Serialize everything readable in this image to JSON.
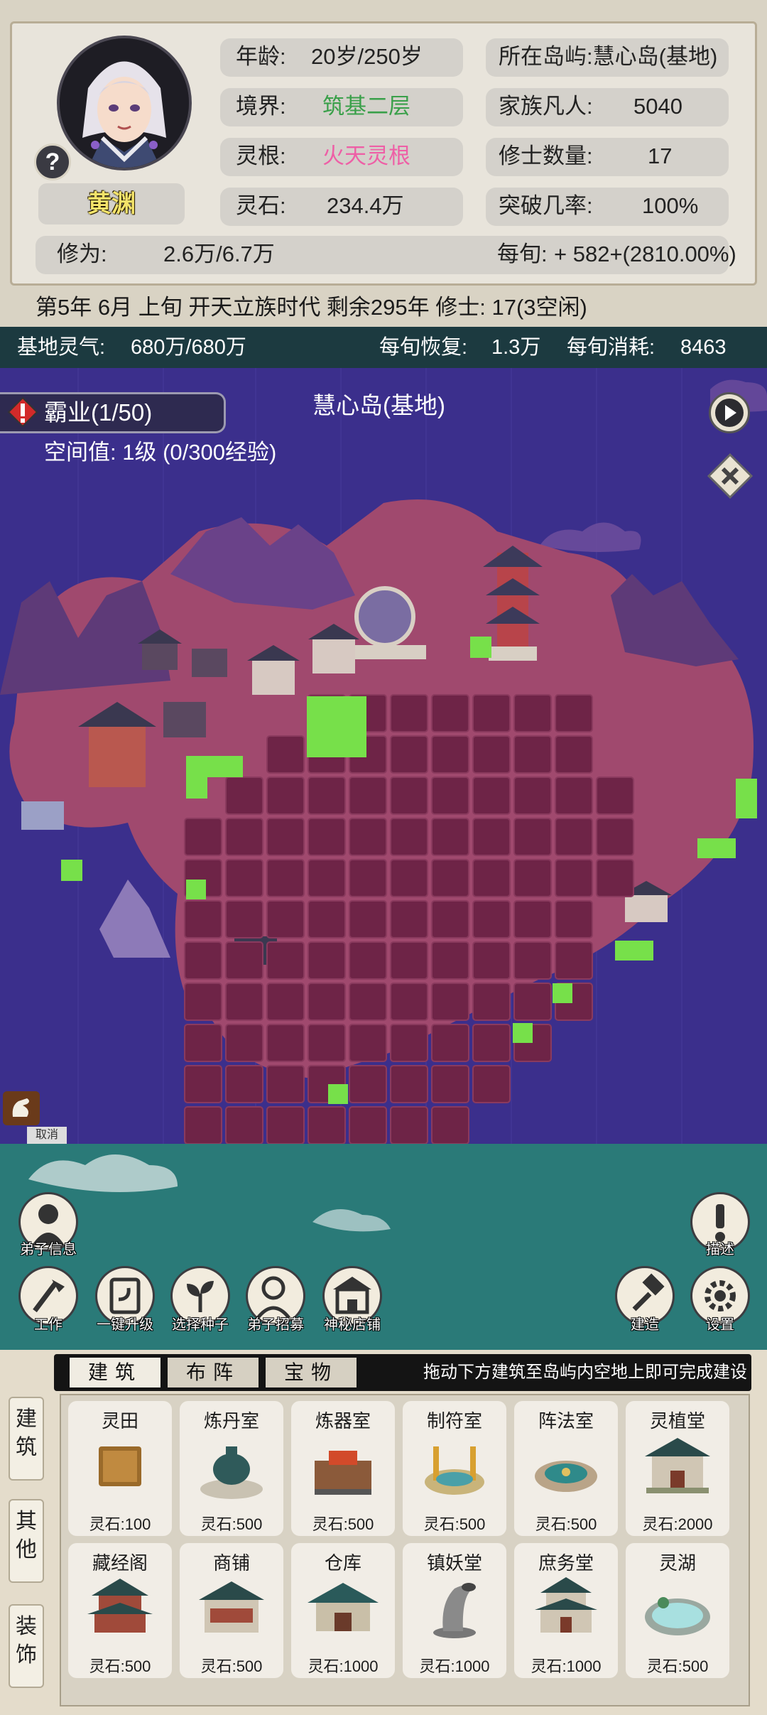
{
  "character": {
    "name": "黄渊",
    "age_label": "年龄:",
    "age_value": "20岁/250岁",
    "realm_label": "境界:",
    "realm_value": "筑基二层",
    "root_label": "灵根:",
    "root_value": "火天灵根",
    "stone_label": "灵石:",
    "stone_value": "234.4万",
    "island_label": "所在岛屿:",
    "island_value": "慧心岛(基地)",
    "mortals_label": "家族凡人:",
    "mortals_value": "5040",
    "cultivators_label": "修士数量:",
    "cultivators_value": "17",
    "breakthrough_label": "突破几率:",
    "breakthrough_value": "100%",
    "cultivation_label": "修为:",
    "cultivation_value": "2.6万/6.7万",
    "per_turn_label": "每旬:",
    "per_turn_value": "+ 582+(2810.00%)",
    "help_symbol": "?"
  },
  "status_line": "第5年 6月 上旬  开天立族时代 剩余295年  修士: 17(3空闲)",
  "spirit": {
    "base_label": "基地灵气:",
    "base_value": "680万/680万",
    "recover_label": "每旬恢复:",
    "recover_value": "1.3万",
    "consume_label": "每旬消耗:",
    "consume_value": "8463"
  },
  "map": {
    "battle": "霸业(1/50)",
    "space_level": "空间值: 1级 (0/300经验)",
    "island_name": "慧心岛(基地)",
    "cancel": "取消",
    "colors": {
      "water": "#3b2f8c",
      "land": "#a0496e",
      "plot": "#6e2447",
      "empty_tile": "#77e04a",
      "mountain": "#5e3a78"
    }
  },
  "actions": {
    "disciple_info": "弟子信息",
    "describe": "描述",
    "work": "工作",
    "upgrade_all": "一键升级",
    "choose_seed": "选择种子",
    "recruit": "弟子招募",
    "mystery_shop": "神秘店铺",
    "build": "建造",
    "settings": "设置"
  },
  "build_panel": {
    "side_tabs": [
      "建筑",
      "其他",
      "装饰"
    ],
    "tabs": [
      "建筑",
      "布阵",
      "宝物"
    ],
    "hint": "拖动下方建筑至岛屿内空地上即可完成建设",
    "buildings": [
      {
        "name": "灵田",
        "price": "灵石:100",
        "icon": "field-icon"
      },
      {
        "name": "炼丹室",
        "price": "灵石:500",
        "icon": "cauldron-icon"
      },
      {
        "name": "炼器室",
        "price": "灵石:500",
        "icon": "forge-icon"
      },
      {
        "name": "制符室",
        "price": "灵石:500",
        "icon": "talisman-altar-icon"
      },
      {
        "name": "阵法室",
        "price": "灵石:500",
        "icon": "formation-disc-icon"
      },
      {
        "name": "灵植堂",
        "price": "灵石:2000",
        "icon": "hall-icon"
      },
      {
        "name": "藏经阁",
        "price": "灵石:500",
        "icon": "pavilion-icon"
      },
      {
        "name": "商铺",
        "price": "灵石:500",
        "icon": "shop-icon"
      },
      {
        "name": "仓库",
        "price": "灵石:1000",
        "icon": "warehouse-icon"
      },
      {
        "name": "镇妖堂",
        "price": "灵石:1000",
        "icon": "horn-icon"
      },
      {
        "name": "庶务堂",
        "price": "灵石:1000",
        "icon": "office-hall-icon"
      },
      {
        "name": "灵湖",
        "price": "灵石:500",
        "icon": "lake-icon"
      }
    ]
  }
}
